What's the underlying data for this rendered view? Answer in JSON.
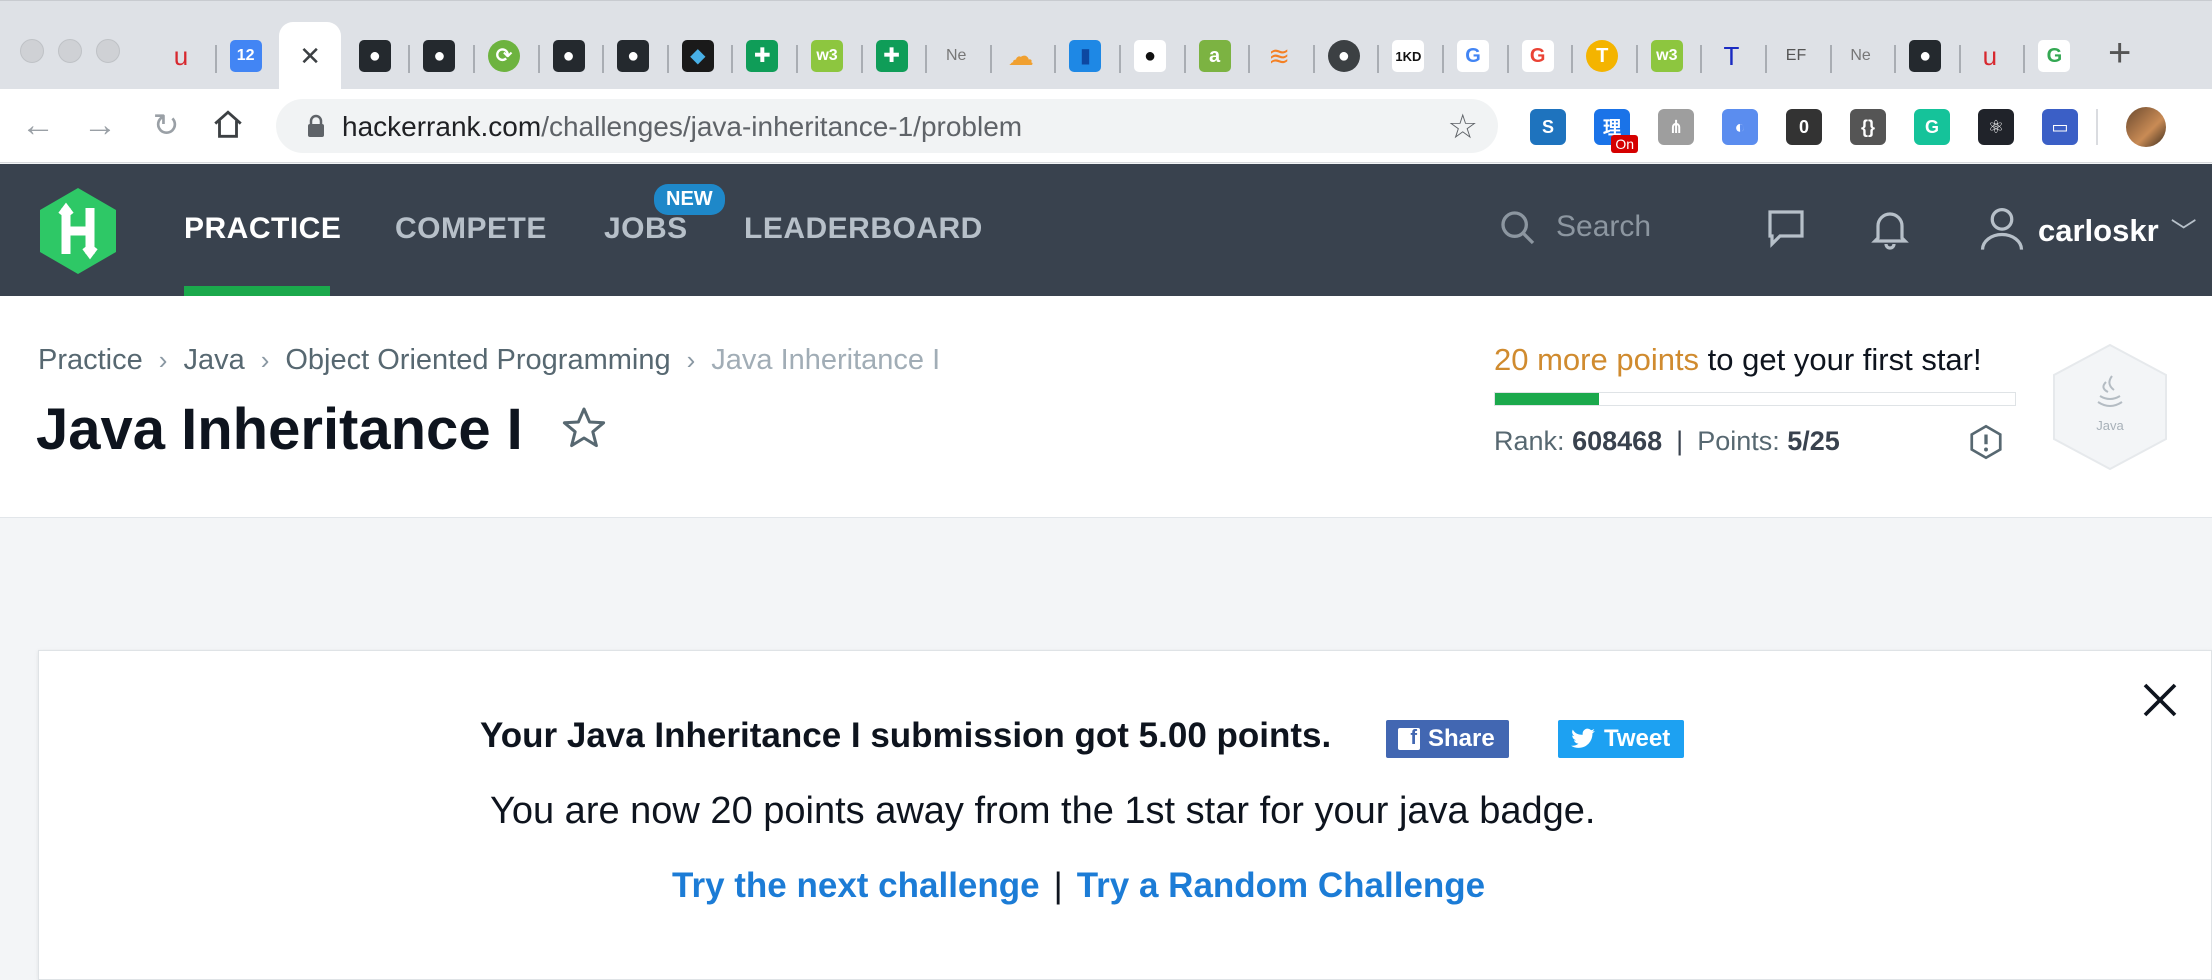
{
  "browser": {
    "tabs": [
      {
        "icon": "acrobat-icon",
        "glyph": "u",
        "bg": "none",
        "fg": "#d7282f"
      },
      {
        "icon": "calendar-icon",
        "glyph": "12",
        "bg": "#4285f4",
        "fg": "#ffffff"
      },
      {
        "icon": "close-tab-icon",
        "glyph": "✕",
        "bg": "none",
        "fg": "#3c4043",
        "active": true
      },
      {
        "icon": "github-icon",
        "glyph": "●",
        "bg": "#24292e",
        "fg": "#ffffff"
      },
      {
        "icon": "github-icon",
        "glyph": "●",
        "bg": "#24292e",
        "fg": "#ffffff"
      },
      {
        "icon": "spring-icon",
        "glyph": "⟳",
        "bg": "#6db33f",
        "fg": "#ffffff",
        "round": true
      },
      {
        "icon": "github-icon",
        "glyph": "●",
        "bg": "#24292e",
        "fg": "#ffffff"
      },
      {
        "icon": "github-icon",
        "glyph": "●",
        "bg": "#24292e",
        "fg": "#ffffff"
      },
      {
        "icon": "bird-icon",
        "glyph": "◆",
        "bg": "#1a1a1a",
        "fg": "#48b0e6"
      },
      {
        "icon": "sheets-icon",
        "glyph": "✚",
        "bg": "#0f9d58",
        "fg": "#ffffff"
      },
      {
        "icon": "w3schools-icon",
        "glyph": "w3",
        "bg": "#8dc63f",
        "fg": "#ffffff"
      },
      {
        "icon": "sheets-icon",
        "glyph": "✚",
        "bg": "#0f9d58",
        "fg": "#ffffff"
      },
      {
        "icon": "text-tab-icon",
        "glyph": "Ne",
        "bg": "none",
        "fg": "#777777"
      },
      {
        "icon": "cloud-icon",
        "glyph": "☁",
        "bg": "none",
        "fg": "#f0a030"
      },
      {
        "icon": "database-icon",
        "glyph": "▮",
        "bg": "#1e88e5",
        "fg": "#0d47a1"
      },
      {
        "icon": "github-icon",
        "glyph": "●",
        "bg": "#ffffff",
        "fg": "#111111"
      },
      {
        "icon": "a-icon",
        "glyph": "a",
        "bg": "#7cb342",
        "fg": "#ffffff"
      },
      {
        "icon": "stackoverflow-icon",
        "glyph": "≋",
        "bg": "none",
        "fg": "#f48024"
      },
      {
        "icon": "globe-icon",
        "glyph": "●",
        "bg": "#3c4043",
        "fg": "#ffffff",
        "round": true
      },
      {
        "icon": "1kd-icon",
        "glyph": "1KD",
        "bg": "#ffffff",
        "fg": "#111111"
      },
      {
        "icon": "google-icon",
        "glyph": "G",
        "bg": "#ffffff",
        "fg": "#4285f4"
      },
      {
        "icon": "google-icon",
        "glyph": "G",
        "bg": "#ffffff",
        "fg": "#ea4335"
      },
      {
        "icon": "translate-icon",
        "glyph": "T",
        "bg": "#f4b400",
        "fg": "#ffffff",
        "round": true
      },
      {
        "icon": "w3schools-icon",
        "glyph": "w3",
        "bg": "#8dc63f",
        "fg": "#ffffff"
      },
      {
        "icon": "t-icon",
        "glyph": "T",
        "bg": "none",
        "fg": "#1a2bc2"
      },
      {
        "icon": "ef-icon",
        "glyph": "EF",
        "bg": "none",
        "fg": "#555555"
      },
      {
        "icon": "text-tab-icon",
        "glyph": "Ne",
        "bg": "none",
        "fg": "#777777"
      },
      {
        "icon": "github-icon",
        "glyph": "●",
        "bg": "#24292e",
        "fg": "#ffffff"
      },
      {
        "icon": "acrobat-icon",
        "glyph": "u",
        "bg": "none",
        "fg": "#d7282f"
      },
      {
        "icon": "google-icon",
        "glyph": "G",
        "bg": "#ffffff",
        "fg": "#34a853"
      }
    ],
    "new_tab": "+",
    "url_host": "hackerrank.com",
    "url_path": "/challenges/java-inheritance-1/problem",
    "extensions": [
      {
        "icon": "s-extension-icon",
        "glyph": "S",
        "bg": "#1e73be"
      },
      {
        "icon": "on-extension-icon",
        "glyph": "理",
        "bg": "#1a73e8",
        "badge": "On"
      },
      {
        "icon": "tree-extension-icon",
        "glyph": "⋔",
        "bg": "#9e9e9e"
      },
      {
        "icon": "circle-extension-icon",
        "glyph": "◐",
        "bg": "#5b8def"
      },
      {
        "icon": "zero-extension-icon",
        "glyph": "0",
        "bg": "#333333"
      },
      {
        "icon": "json-extension-icon",
        "glyph": "{}",
        "bg": "#555555"
      },
      {
        "icon": "grammarly-icon",
        "glyph": "G",
        "bg": "#15c39a"
      },
      {
        "icon": "react-icon",
        "glyph": "⚛",
        "bg": "#20232a"
      },
      {
        "icon": "card-extension-icon",
        "glyph": "▭",
        "bg": "#3b5fc6"
      }
    ]
  },
  "hr": {
    "nav": {
      "practice": "PRACTICE",
      "compete": "COMPETE",
      "jobs": "JOBS",
      "jobs_badge": "NEW",
      "leaderboard": "LEADERBOARD"
    },
    "search_placeholder": "Search",
    "username": "carloskr",
    "accent": "#1ba94c",
    "header_bg": "#39424e"
  },
  "page": {
    "breadcrumb": [
      "Practice",
      "Java",
      "Object Oriented Programming",
      "Java Inheritance I"
    ],
    "title": "Java Inheritance I",
    "progress": {
      "highlight": "20 more points",
      "rest": " to get your first star!",
      "fraction": 0.2
    },
    "rank_label": "Rank:",
    "rank_value": "608468",
    "points_label": "Points:",
    "points_value": "5/25",
    "badge_label": "Java"
  },
  "notice": {
    "line1": "Your Java Inheritance I submission got 5.00 points.",
    "share_fb": "Share",
    "share_tw": "Tweet",
    "line2": "You are now 20 points away from the 1st star for your java badge.",
    "next_link": "Try the next challenge",
    "separator": "|",
    "random_link": "Try a Random Challenge"
  }
}
